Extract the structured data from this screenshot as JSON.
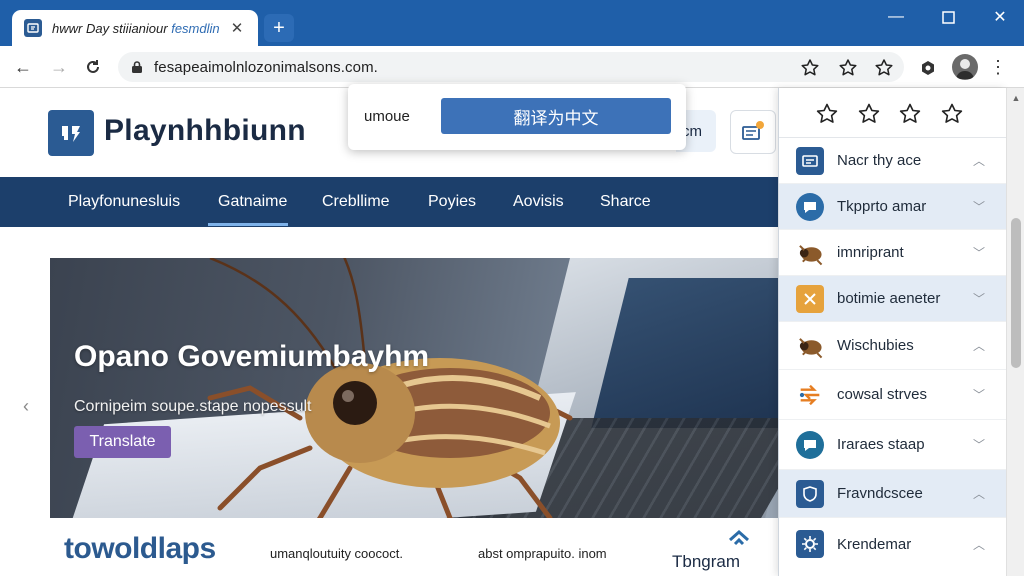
{
  "browser": {
    "tab_title_main": "hwwr Day stiiianiour",
    "tab_title_accent": "fesmdlin",
    "address": "fesapeaimolnlozonimalsons.com."
  },
  "site": {
    "name": "Playnhhbiunn",
    "header_pill": "cm"
  },
  "nav": [
    "Playfonunesluis",
    "Gatnaime",
    "Crebllime",
    "Poyies",
    "Aovisis",
    "Sharce"
  ],
  "hero": {
    "title": "Opano Govemiumbayhm",
    "subtitle": "Cornipeim soupe.stape nopessult",
    "button": "Translate"
  },
  "strip": {
    "brand": "towoldlaps",
    "text1": "umanqloutuity coococt.",
    "text2": "abst omprapuito. inom",
    "logo_text": "Tbngram"
  },
  "translate_popup": {
    "label": "umoue",
    "button": "翻译为中文"
  },
  "panel": {
    "items": [
      {
        "label": "Nacr thy ace",
        "icon": "folder-app-icon",
        "color": "#2b5b93",
        "chevron": "up",
        "highlight": false
      },
      {
        "label": "Tkpprto amar",
        "icon": "chat-bubble-icon",
        "color": "#2b6ca8",
        "chevron": "down",
        "highlight": true
      },
      {
        "label": "imnriprant",
        "icon": "bug-icon",
        "color": "#8b5a2b",
        "chevron": "down",
        "highlight": false
      },
      {
        "label": "botimie aeneter",
        "icon": "tools-icon",
        "color": "#e6a23c",
        "chevron": "down",
        "highlight": true
      },
      {
        "label": "Wischubies",
        "icon": "bug-icon",
        "color": "#8b5a2b",
        "chevron": "up",
        "highlight": false
      },
      {
        "label": "cowsal strves",
        "icon": "arrows-icon",
        "color": "#e67e22",
        "chevron": "down",
        "highlight": false
      },
      {
        "label": "Iraraes staap",
        "icon": "chat-bubble-icon",
        "color": "#1f6f9a",
        "chevron": "down",
        "highlight": false
      },
      {
        "label": "Fravndcscee",
        "icon": "shield-icon",
        "color": "#2b5b93",
        "chevron": "up",
        "highlight": true
      },
      {
        "label": "Krendemar",
        "icon": "gear-icon",
        "color": "#2b5b93",
        "chevron": "up",
        "highlight": false
      }
    ]
  },
  "colors": {
    "chrome": "#1f5fa9",
    "nav_bar": "#1c3f6b",
    "accent_button": "#3d72b8",
    "hero_button": "#7b5fb0"
  }
}
